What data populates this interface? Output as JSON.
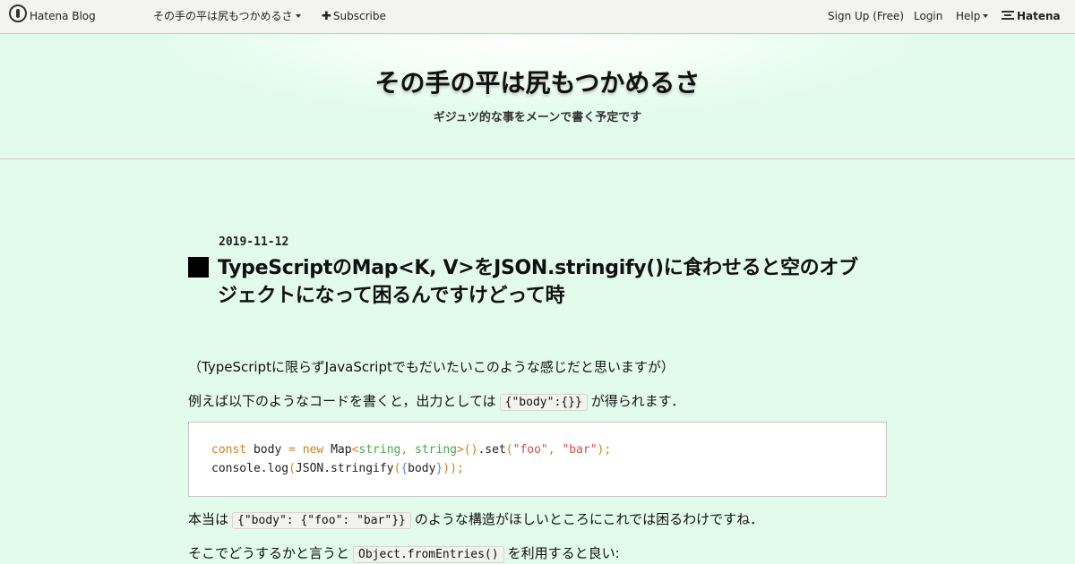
{
  "nav": {
    "logo_text": "Hatena Blog",
    "blog_menu_label": "その手の平は尻もつかめるさ",
    "subscribe_label": "Subscribe",
    "signup_label": "Sign Up (Free)",
    "login_label": "Login",
    "help_label": "Help",
    "hatena_label": "Hatena"
  },
  "blog": {
    "title": "その手の平は尻もつかめるさ",
    "description": "ギジュツ的な事をメーンで書く予定です"
  },
  "entry": {
    "date": "2019-11-12",
    "title": "TypeScriptのMap<K, V>をJSON.stringify()に食わせると空のオブジェクトになって困るんですけどって時",
    "p1": "（TypeScriptに限らずJavaScriptでもだいたいこのような感じだと思いますが）",
    "p2_before": "例えば以下のようなコードを書くと，出力としては",
    "p2_code": "{\"body\":{}}",
    "p2_after": "が得られます．",
    "code": {
      "l1_const": "const",
      "l1_body": " body ",
      "l1_eq": "=",
      "l1_new": "new",
      "l1_map": " Map",
      "l1_lt": "<",
      "l1_t1": "string",
      "l1_comma": ", ",
      "l1_t2": "string",
      "l1_gt": ">",
      "l1_call": "()",
      "l1_set": ".set",
      "l1_po": "(",
      "l1_s1": "\"foo\"",
      "l1_c2": ", ",
      "l1_s2": "\"bar\"",
      "l1_end": ");",
      "l2_console": "console.log",
      "l2_po": "(",
      "l2_json": "JSON.stringify",
      "l2_po2": "(",
      "l2_bo": "{",
      "l2_body": "body",
      "l2_bc": "}",
      "l2_end": "));"
    },
    "p3_before": "本当は",
    "p3_code": "{\"body\": {\"foo\": \"bar\"}}",
    "p3_after": "のような構造がほしいところにこれでは困るわけですね．",
    "p4_before": "そこでどうするかと言うと",
    "p4_code": "Object.fromEntries()",
    "p4_after": "を利用すると良い:"
  }
}
